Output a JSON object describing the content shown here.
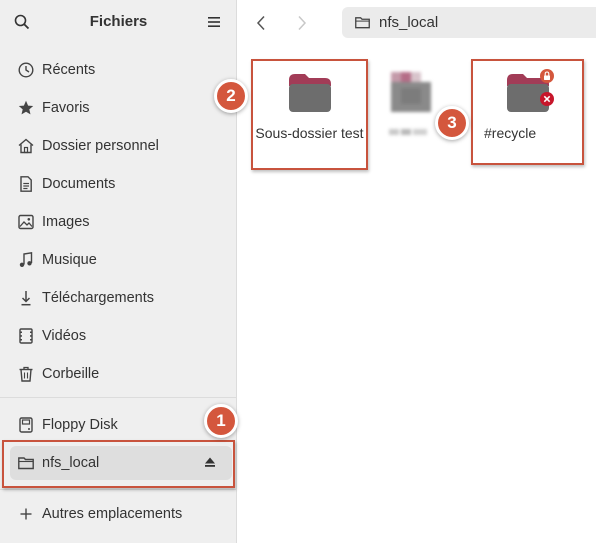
{
  "sidebar": {
    "title": "Fichiers",
    "places": [
      {
        "label": "Récents",
        "icon": "clock-icon"
      },
      {
        "label": "Favoris",
        "icon": "star-icon"
      },
      {
        "label": "Dossier personnel",
        "icon": "home-icon"
      },
      {
        "label": "Documents",
        "icon": "document-icon"
      },
      {
        "label": "Images",
        "icon": "image-icon"
      },
      {
        "label": "Musique",
        "icon": "music-icon"
      },
      {
        "label": "Téléchargements",
        "icon": "download-icon"
      },
      {
        "label": "Vidéos",
        "icon": "video-icon"
      },
      {
        "label": "Corbeille",
        "icon": "trash-icon"
      }
    ],
    "devices": [
      {
        "label": "Floppy Disk",
        "icon": "drive-icon"
      },
      {
        "label": "nfs_local",
        "icon": "folder-network-icon",
        "selected": true
      }
    ],
    "other_locations": {
      "label": "Autres emplacements",
      "icon": "plus-icon"
    }
  },
  "toolbar": {
    "path": "nfs_local"
  },
  "files": [
    {
      "label": "Sous-dossier test"
    },
    {
      "label": ""
    },
    {
      "label": "#recycle",
      "emblems": [
        "lock-emblem-icon",
        "unreadable-emblem-icon"
      ]
    }
  ],
  "annotations": [
    {
      "number": "1"
    },
    {
      "number": "2"
    },
    {
      "number": "3"
    }
  ],
  "colors": {
    "accent": "#c8533d",
    "badge": "#d4573d",
    "folder_tab": "#a23c57",
    "folder_body": "#6d6d6d",
    "sidebar_bg": "#efefef"
  }
}
